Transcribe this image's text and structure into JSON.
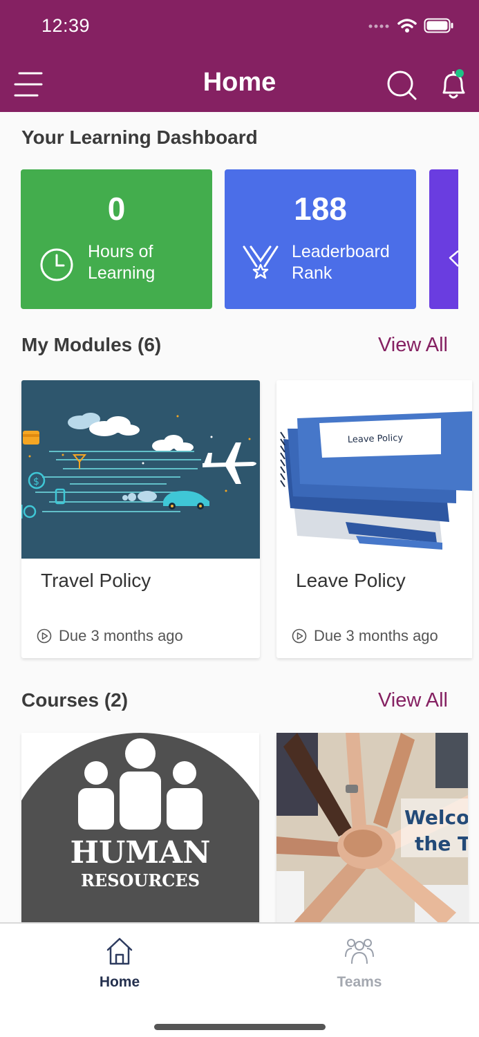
{
  "status_bar": {
    "time": "12:39"
  },
  "header": {
    "title": "Home"
  },
  "dashboard": {
    "title": "Your Learning Dashboard",
    "cards": [
      {
        "value": "0",
        "label_line1": "Hours of",
        "label_line2": "Learning",
        "icon": "clock-icon",
        "color": "#43ad4d"
      },
      {
        "value": "188",
        "label_line1": "Leaderboard",
        "label_line2": "Rank",
        "icon": "medal-icon",
        "color": "#4b6ee8"
      },
      {
        "icon": "badge-icon",
        "color": "#6a3de0"
      }
    ]
  },
  "modules": {
    "title": "My Modules (6)",
    "view_all": "View All",
    "items": [
      {
        "title": "Travel Policy",
        "due": "Due 3 months ago"
      },
      {
        "title": "Leave Policy",
        "due": "Due 3 months ago",
        "image_text": "Leave Policy"
      }
    ]
  },
  "courses": {
    "title": "Courses (2)",
    "view_all": "View All",
    "items": [
      {
        "image_text_line1": "HUMAN",
        "image_text_line2": "RESOURCES"
      },
      {
        "image_text_line1": "Welcor",
        "image_text_line2": "the Te"
      }
    ]
  },
  "bottom_nav": {
    "items": [
      {
        "label": "Home",
        "icon": "home-icon",
        "active": true
      },
      {
        "label": "Teams",
        "icon": "teams-icon",
        "active": false
      }
    ]
  },
  "colors": {
    "brand": "#852162",
    "green": "#43ad4d",
    "blue": "#4b6ee8",
    "purple": "#6a3de0"
  }
}
